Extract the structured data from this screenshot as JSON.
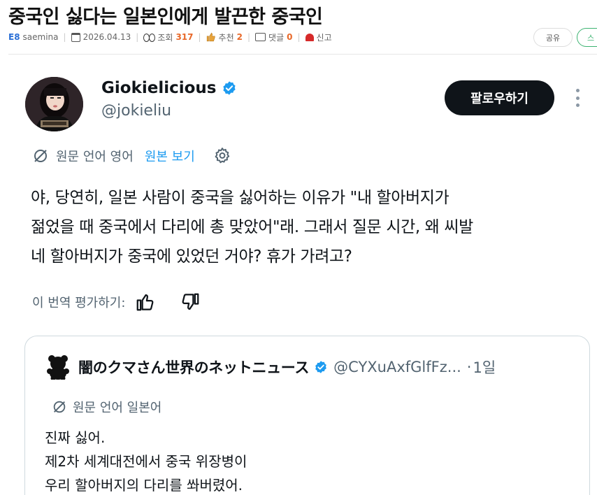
{
  "post": {
    "title": "중국인 싫다는 일본인에게 발끈한 중국인",
    "board": "E8",
    "author": "saemina",
    "date": "2026.04.13",
    "views_label": "조회",
    "views": "317",
    "likes_label": "추천",
    "likes": "2",
    "comments_label": "댓글",
    "comments": "0",
    "report_label": "신고",
    "share_label": "공유",
    "next_label": "스"
  },
  "tweet": {
    "author_name": "Giokielicious",
    "author_handle": "@jokieliu",
    "follow_label": "팔로우하기",
    "translation_label": "원문 언어 영어",
    "view_original_label": "원본 보기",
    "body_lines": [
      "야, 당연히, 일본 사람이 중국을 싫어하는 이유가 \"내 할아버지가",
      "젊었을 때 중국에서 다리에 총 맞았어\"래. 그래서 질문 시간, 왜 씨발",
      "네 할아버지가 중국에 있었던 거야? 휴가 가려고?"
    ],
    "rate_label": "이 번역 평가하기:"
  },
  "quoted_tweet": {
    "author_name": "闇のクマさん世界のネットニュース",
    "author_handle": "@CYXuAxfGlfFz...",
    "separator": "·",
    "time": "1일",
    "translation_label": "원문 언어 일본어",
    "body_lines": [
      "진짜 싫어.",
      "제2차 세계대전에서 중국 위장병이",
      "우리 할아버지의 다리를 쏴버렸어."
    ]
  },
  "icons": {
    "verified": "verified-badge-icon",
    "translate": "translate-icon",
    "settings": "gear-icon",
    "thumbs_up": "thumbs-up-icon",
    "thumbs_down": "thumbs-down-icon",
    "more": "more-vertical-icon",
    "bear": "bear-icon"
  },
  "colors": {
    "accent_blue": "#1d9bf0",
    "text_primary": "#0f1419",
    "text_secondary": "#536471",
    "follow_button": "#0f1419",
    "board_tag": "#2a6fd6",
    "views_count": "#e8692a"
  }
}
